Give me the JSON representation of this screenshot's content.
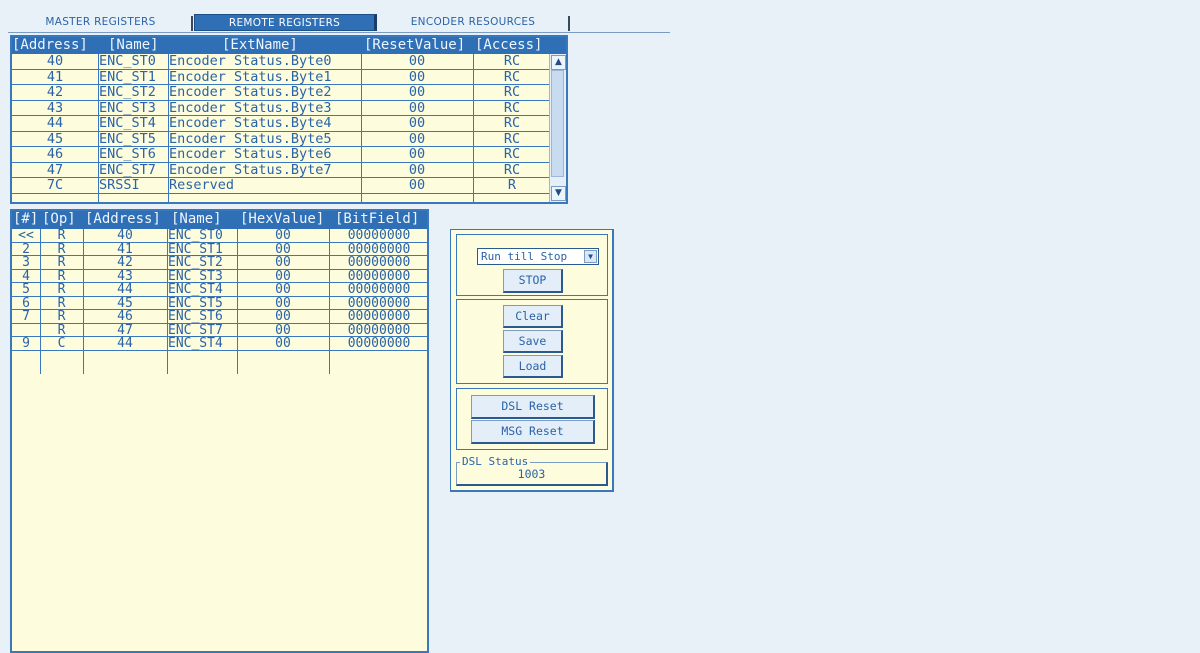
{
  "tabs": [
    "MASTER REGISTERS",
    "REMOTE REGISTERS",
    "ENCODER RESOURCES"
  ],
  "reg_table": {
    "headers": [
      "[Address]",
      "[Name]",
      "[ExtName]",
      "[ResetValue]",
      "[Access]"
    ],
    "rows": [
      {
        "address": "40",
        "name": "ENC_ST0",
        "ext": "Encoder Status.Byte0",
        "reset": "00",
        "access": "RC"
      },
      {
        "address": "41",
        "name": "ENC_ST1",
        "ext": "Encoder Status.Byte1",
        "reset": "00",
        "access": "RC"
      },
      {
        "address": "42",
        "name": "ENC_ST2",
        "ext": "Encoder Status.Byte2",
        "reset": "00",
        "access": "RC"
      },
      {
        "address": "43",
        "name": "ENC_ST3",
        "ext": "Encoder Status.Byte3",
        "reset": "00",
        "access": "RC"
      },
      {
        "address": "44",
        "name": "ENC_ST4",
        "ext": "Encoder Status.Byte4",
        "reset": "00",
        "access": "RC"
      },
      {
        "address": "45",
        "name": "ENC_ST5",
        "ext": "Encoder Status.Byte5",
        "reset": "00",
        "access": "RC"
      },
      {
        "address": "46",
        "name": "ENC_ST6",
        "ext": "Encoder Status.Byte6",
        "reset": "00",
        "access": "RC"
      },
      {
        "address": "47",
        "name": "ENC_ST7",
        "ext": "Encoder Status.Byte7",
        "reset": "00",
        "access": "RC"
      },
      {
        "address": "7C",
        "name": "SRSSI",
        "ext": "Reserved",
        "reset": "00",
        "access": "R"
      }
    ]
  },
  "log_table": {
    "headers": [
      "[#]",
      "[Op]",
      "[Address]",
      "[Name]",
      "[HexValue]",
      "[BitField]"
    ],
    "rows": [
      {
        "num": "<<",
        "op": "R",
        "address": "40",
        "name": "ENC_ST0",
        "hex": "00",
        "bits": "00000000"
      },
      {
        "num": "2",
        "op": "R",
        "address": "41",
        "name": "ENC_ST1",
        "hex": "00",
        "bits": "00000000"
      },
      {
        "num": "3",
        "op": "R",
        "address": "42",
        "name": "ENC_ST2",
        "hex": "00",
        "bits": "00000000"
      },
      {
        "num": "4",
        "op": "R",
        "address": "43",
        "name": "ENC_ST3",
        "hex": "00",
        "bits": "00000000"
      },
      {
        "num": "5",
        "op": "R",
        "address": "44",
        "name": "ENC_ST4",
        "hex": "00",
        "bits": "00000000"
      },
      {
        "num": "6",
        "op": "R",
        "address": "45",
        "name": "ENC_ST5",
        "hex": "00",
        "bits": "00000000"
      },
      {
        "num": "7",
        "op": "R",
        "address": "46",
        "name": "ENC_ST6",
        "hex": "00",
        "bits": "00000000"
      },
      {
        "num": "",
        "op": "R",
        "address": "47",
        "name": "ENC_ST7",
        "hex": "00",
        "bits": "00000000"
      },
      {
        "num": "9",
        "op": "C",
        "address": "44",
        "name": "ENC_ST4",
        "hex": "00",
        "bits": "00000000"
      }
    ]
  },
  "controls": {
    "mode_select": "Run till Stop",
    "stop": "STOP",
    "clear": "Clear",
    "save": "Save",
    "load": "Load",
    "dsl_reset": "DSL Reset",
    "msg_reset": "MSG Reset",
    "dsl_status_label": "DSL Status",
    "dsl_status_value": "1003"
  },
  "colors": {
    "accent": "#2f6fb6",
    "panel_bg": "#fdfcdc",
    "page_bg": "#e8f1f8",
    "text": "#2a63a8"
  }
}
